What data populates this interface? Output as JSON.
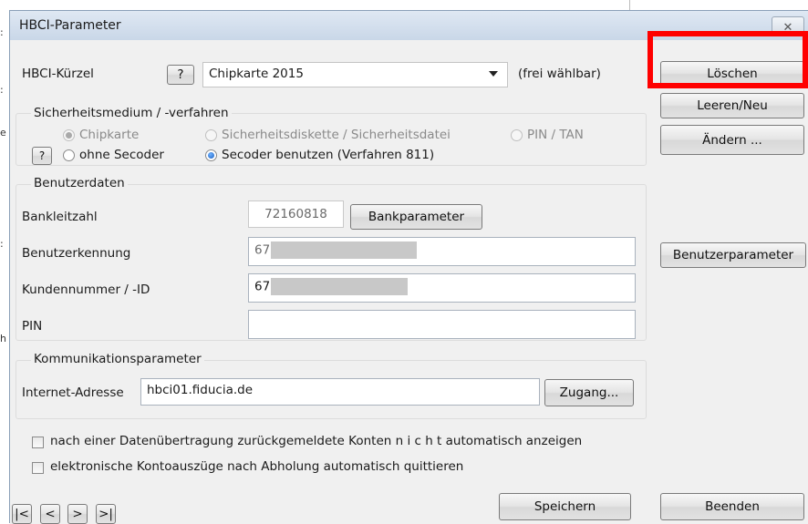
{
  "window": {
    "title": "HBCI-Parameter",
    "close_glyph": "✕",
    "background_marks": [
      ":",
      ":",
      "e",
      ":",
      "h"
    ]
  },
  "profile": {
    "label": "HBCI-Kürzel",
    "help_glyph": "?",
    "value": "Chipkarte 2015",
    "hint": "(frei wählbar)"
  },
  "security": {
    "group_label": "Sicherheitsmedium / -verfahren",
    "help_glyph": "?",
    "options": {
      "chipkarte": "Chipkarte",
      "diskette": "Sicherheitsdiskette / Sicherheitsdatei",
      "pintan": "PIN / TAN",
      "ohne_secoder": "ohne Secoder",
      "secoder": "Secoder benutzen (Verfahren 811)"
    }
  },
  "user": {
    "group_label": "Benutzerdaten",
    "bankleitzahl_label": "Bankleitzahl",
    "bankleitzahl_value": "72160818",
    "bankparameter_button": "Bankparameter",
    "benutzerkennung_label": "Benutzerkennung",
    "benutzerkennung_value": "67",
    "kundennummer_label": "Kundennummer / -ID",
    "kundennummer_value": "67",
    "pin_label": "PIN",
    "pin_value": ""
  },
  "communication": {
    "group_label": "Kommunikationsparameter",
    "address_label": "Internet-Adresse",
    "address_value": "hbci01.fiducia.de",
    "access_button": "Zugang..."
  },
  "options": {
    "no_auto_show": "nach einer Datenübertragung zurückgemeldete Konten  n i c h t  automatisch anzeigen",
    "auto_acknowledge": "elektronische Kontoauszüge nach Abholung automatisch quittieren"
  },
  "side_buttons": {
    "delete": "Löschen",
    "clear_new": "Leeren/Neu",
    "change": "Ändern ...",
    "user_params": "Benutzerparameter"
  },
  "navigation": {
    "first": "|<",
    "prev": "<",
    "next": ">",
    "last": ">|"
  },
  "footer": {
    "save": "Speichern",
    "exit": "Beenden"
  },
  "colors": {
    "highlight_border": "#ff0000",
    "dialog_background": "#f0f0f0",
    "radio_selected": "#1c5fbf"
  }
}
